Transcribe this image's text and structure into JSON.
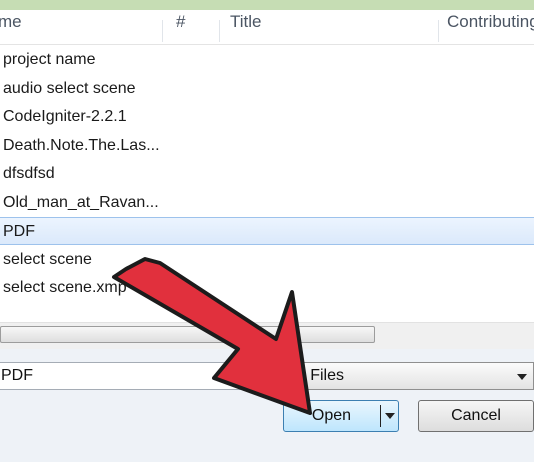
{
  "columns": {
    "name": "me",
    "number": "#",
    "title": "Title",
    "contributing": "Contributing"
  },
  "files": [
    {
      "name": "project name",
      "selected": false
    },
    {
      "name": "audio select scene",
      "selected": false
    },
    {
      "name": "CodeIgniter-2.2.1",
      "selected": false
    },
    {
      "name": "Death.Note.The.Las...",
      "selected": false
    },
    {
      "name": "dfsdfsd",
      "selected": false
    },
    {
      "name": "Old_man_at_Ravan...",
      "selected": false
    },
    {
      "name": "PDF",
      "selected": true
    },
    {
      "name": "select scene",
      "selected": false
    },
    {
      "name": "select scene.xmp",
      "selected": false
    }
  ],
  "filename_input": {
    "value": "PDF"
  },
  "filetype_select": {
    "value": "All Files"
  },
  "buttons": {
    "open_label": "Open",
    "cancel_label": "Cancel"
  },
  "annotation": {
    "icon": "red-arrow-icon",
    "color": "#e1303d"
  }
}
